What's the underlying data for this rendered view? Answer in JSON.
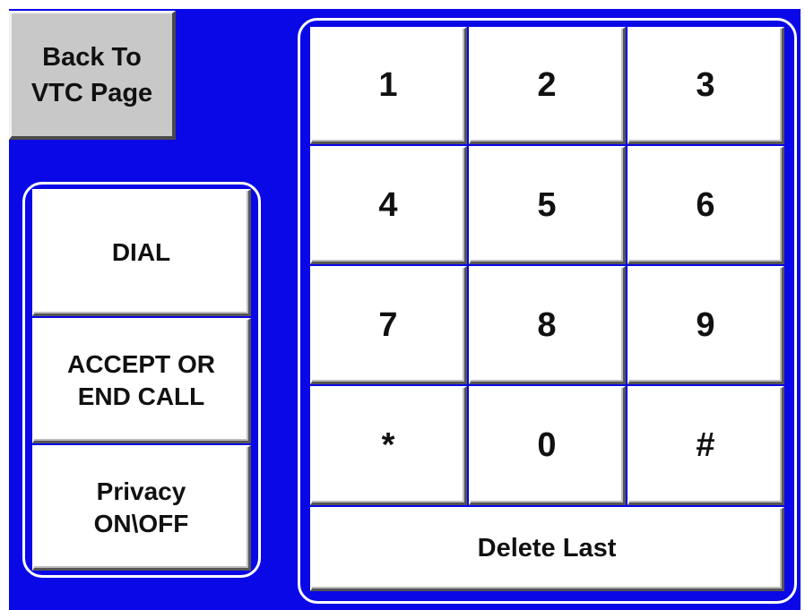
{
  "back_button": {
    "label": "Back To\nVTC Page"
  },
  "controls": {
    "dial_label": "DIAL",
    "accept_end_label": "ACCEPT OR\nEND CALL",
    "privacy_label": "Privacy\nON\\OFF"
  },
  "keypad": {
    "keys": [
      "1",
      "2",
      "3",
      "4",
      "5",
      "6",
      "7",
      "8",
      "9",
      "*",
      "0",
      "#"
    ],
    "delete_label": "Delete Last"
  },
  "colors": {
    "background": "#0a08e6",
    "button_face": "#ffffff",
    "back_button_face": "#c8c8c8",
    "frame_border": "#ffffff"
  }
}
